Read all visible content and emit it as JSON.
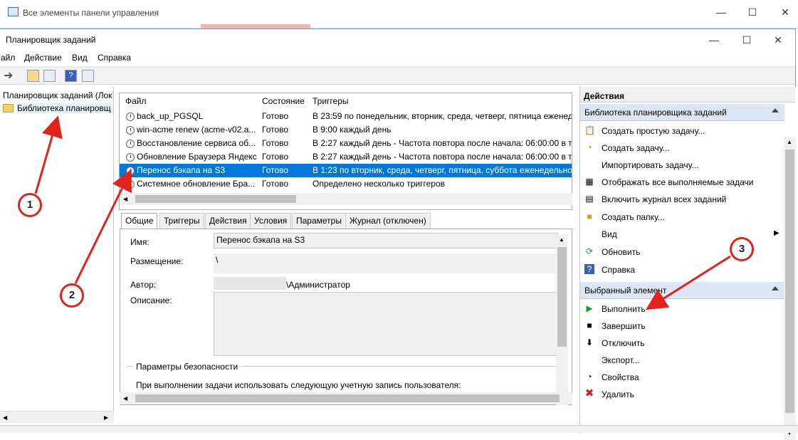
{
  "back_window": {
    "title": "Все элементы панели управления"
  },
  "window": {
    "title": "Планировщик заданий",
    "minimize": "—",
    "maximize": "☐",
    "close": "✕"
  },
  "menu": [
    "айл",
    "Действие",
    "Вид",
    "Справка"
  ],
  "tree": {
    "root": "Планировщик заданий (Лок",
    "library": "Библиотека планировщ"
  },
  "list": {
    "columns": [
      "Файл",
      "Состояние",
      "Триггеры"
    ],
    "rows": [
      {
        "name": "back_up_PGSQL",
        "state": "Готово",
        "trigger": "В 23:59 по понедельник, вторник, среда, четверг, пятница еженедел"
      },
      {
        "name": "win-acme renew (acme-v02.a...",
        "state": "Готово",
        "trigger": "В 9:00 каждый день"
      },
      {
        "name": "Восстановление сервиса об...",
        "state": "Готово",
        "trigger": "В 2:27 каждый день - Частота повтора после начала: 06:00:00 в течо"
      },
      {
        "name": "Обновление Браузера Яндекс",
        "state": "Готово",
        "trigger": "В 2:27 каждый день - Частота повтора после начала: 06:00:00 в теч"
      },
      {
        "name": "Перенос бэкапа на S3",
        "state": "Готово",
        "trigger": "В 1:23 по вторник, среда, четверг, пятница, суббота еженедельно, н"
      },
      {
        "name": "Системное обновление Бра...",
        "state": "Готово",
        "trigger": "Определено несколько триггеров"
      }
    ]
  },
  "tabs": [
    "Общие",
    "Триггеры",
    "Действия",
    "Условия",
    "Параметры",
    "Журнал (отключен)"
  ],
  "details": {
    "name_label": "Имя:",
    "name_value": "Перенос бэкапа на S3",
    "location_label": "Размещение:",
    "location_value": "\\",
    "author_label": "Автор:",
    "author_value": "\\Администратор",
    "desc_label": "Описание:",
    "security_label": "Параметры безопасности",
    "security_text": "При выполнении задачи использовать следующую учетную запись пользователя:"
  },
  "actions": {
    "header": "Действия",
    "section1": "Библиотека планировщика заданий",
    "items1": [
      "Создать простую задачу...",
      "Создать задачу...",
      "Импортировать задачу...",
      "Отображать все выполняемые задачи",
      "Включить журнал всех заданий",
      "Создать папку...",
      "Вид",
      "Обновить",
      "Справка"
    ],
    "section2": "Выбранный элемент",
    "items2": [
      "Выполнить",
      "Завершить",
      "Отключить",
      "Экспорт...",
      "Свойства",
      "Удалить"
    ]
  },
  "annotations": [
    "1",
    "2",
    "3"
  ],
  "colors": {
    "selection": "#0078d7",
    "annotation": "#e3231b",
    "section": "#dce6f4"
  }
}
